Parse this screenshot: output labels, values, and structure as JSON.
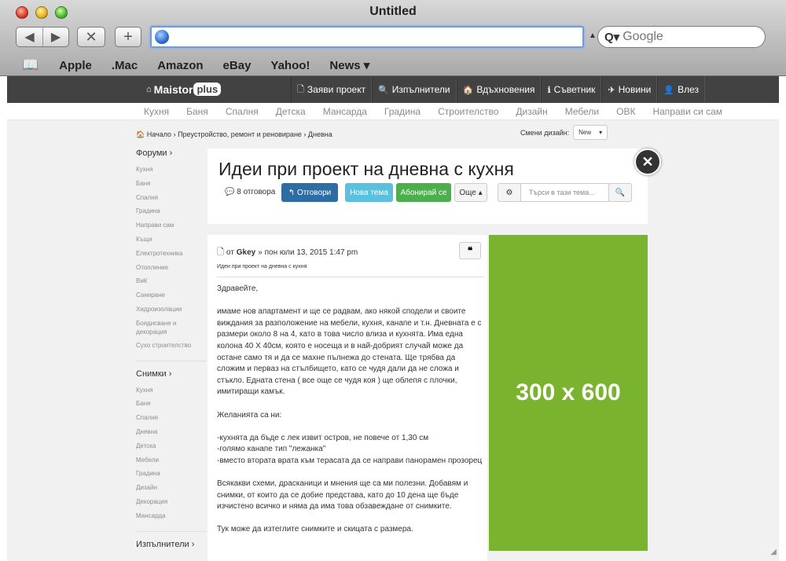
{
  "browser": {
    "window_title": "Untitled",
    "url_value": "",
    "search_placeholder": "Google",
    "bookmarks": [
      "Apple",
      ".Mac",
      "Amazon",
      "eBay",
      "Yahoo!",
      "News ▾"
    ]
  },
  "site": {
    "logo_text": "Maistor",
    "logo_plus": "plus",
    "nav": [
      {
        "icon": "🗋",
        "label": "Заяви проект"
      },
      {
        "icon": "🔍",
        "label": "Изпълнители"
      },
      {
        "icon": "🏠",
        "label": "Вдъхновения"
      },
      {
        "icon": "ℹ",
        "label": "Съветник"
      },
      {
        "icon": "✈",
        "label": "Новини"
      },
      {
        "icon": "👤",
        "label": "Влез"
      }
    ],
    "categories": [
      "Кухня",
      "Баня",
      "Спалня",
      "Детска",
      "Мансарда",
      "Градина",
      "Строителство",
      "Дизайн",
      "Мебели",
      "ОВК",
      "Направи си сам"
    ]
  },
  "breadcrumb": "🏠 Начало › Преустройство, ремонт и реновиране › Дневна",
  "theme": {
    "label": "Смени дизайн:",
    "value": "New"
  },
  "sidebar": {
    "forums_head": "Форуми ›",
    "forums": [
      "Кухня",
      "Баня",
      "Спалня",
      "Градина",
      "Направи сам",
      "Къщи",
      "Електротехника",
      "Отопление",
      "ВиК",
      "Саниране",
      "Хидроизолации",
      "Боядисване и декорация",
      "Сухо строителство"
    ],
    "photos_head": "Снимки ›",
    "photos": [
      "Кухня",
      "Баня",
      "Спалня",
      "Дневна",
      "Детска",
      "Мебели",
      "Градина",
      "Дизайн",
      "Декорация",
      "Мансарда"
    ],
    "contractors_head": "Изпълнители ›"
  },
  "topic": {
    "title": "Идеи при проект на дневна с кухня",
    "replies": "8 отговора",
    "reply_btn": "Отговори",
    "new_topic_btn": "Нова тема",
    "subscribe_btn": "Абонирай се",
    "more_btn": "Още ▴",
    "search_placeholder": "Търси в тази тема..."
  },
  "post": {
    "meta_prefix": "от",
    "author": "Gkey",
    "date": "» пон юли 13, 2015 1:47 pm",
    "subject": "Идеи при проект на дневна с кухня",
    "paragraphs": [
      "Здравейте,",
      "имаме нов апартамент и ще се радвам, ако някой сподели и своите виждания за разположение на мебели, кухня, канапе и т.н. Дневната е с размери около 8 на 4, като в това число влиза и кухнята. Има една колона 40 Х 40см, която е носеща и в най-добрият случай може да остане само тя и да се махне пълнежа до стената. Ще трябва да сложим и первaз на стълбището, като се чудя дали да не сложа и стъкло. Едната стена ( все още се чудя коя ) ще облепя с плочки, имитиращи камък.",
      "Желанията са ни:",
      "-кухнята да бъде с лек извит остров, не повече от 1,30 см\n-голямо канапе тип \"лежанка\"\n-вместо втората врата към терасата да се направи панорамен прозорец",
      "Всякакви схеми, драсканици и мнения ще са ми полезни. Добавям и снимки, от които да се добие представа, като до 10 дена ще бъде изчистено всичко и няма да има това обзавеждане от снимките.",
      "Тук може да изтеглите снимките и скицата с размера."
    ]
  },
  "ad": {
    "label": "300 x 600",
    "color": "#7ab42e"
  }
}
